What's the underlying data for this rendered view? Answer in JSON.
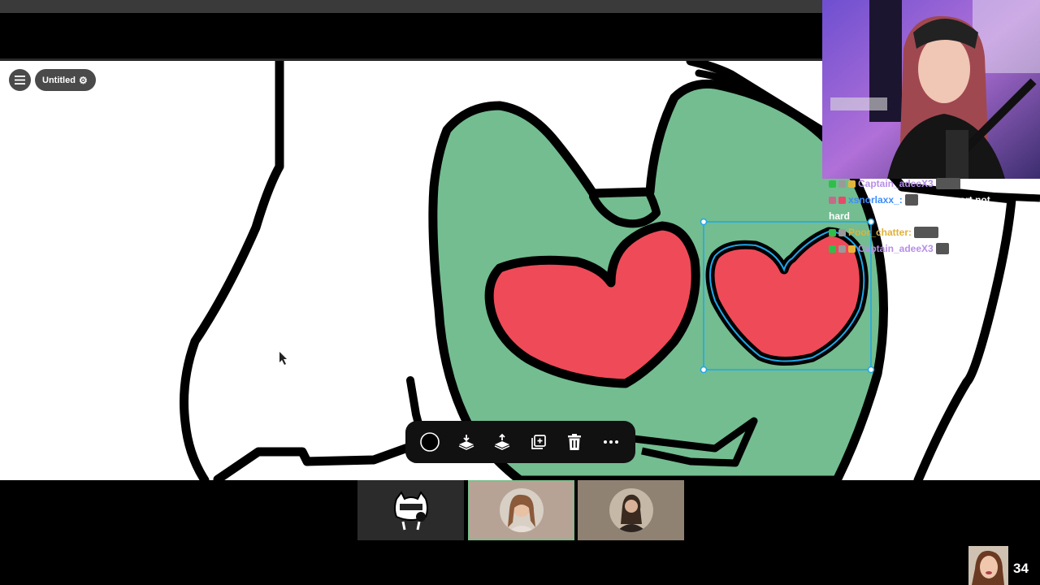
{
  "document": {
    "title": "Untitled"
  },
  "icons": {
    "menu": "hamburger-icon",
    "settings": "gear-icon",
    "color": "circle-icon",
    "send_backward": "layer-down-icon",
    "bring_forward": "layer-up-icon",
    "duplicate": "duplicate-icon",
    "delete": "trash-icon",
    "more": "more-horizontal-icon"
  },
  "colors": {
    "frog_green": "#73bd91",
    "heart_red": "#ef4a58",
    "outline": "#000000",
    "selection": "#1ea7e8",
    "toolbar_bg": "#111111"
  },
  "chat": {
    "lines": [
      {
        "user": "Captain_adeeX3",
        "message": "",
        "user_color": "purple"
      },
      {
        "user": "xsnorlaxx_:",
        "message": "work smart not",
        "user_color": "blue"
      },
      {
        "user": "",
        "message": "hard",
        "user_color": ""
      },
      {
        "user": "Poor_chatter:",
        "message": "",
        "user_color": "gold"
      },
      {
        "user": "Captain_adeeX3",
        "message": "",
        "user_color": "purple"
      }
    ]
  },
  "participants": [
    {
      "name": "",
      "active": false
    },
    {
      "name": "",
      "active": true
    },
    {
      "name": "",
      "active": false
    }
  ],
  "stream": {
    "viewer_count": "34"
  }
}
